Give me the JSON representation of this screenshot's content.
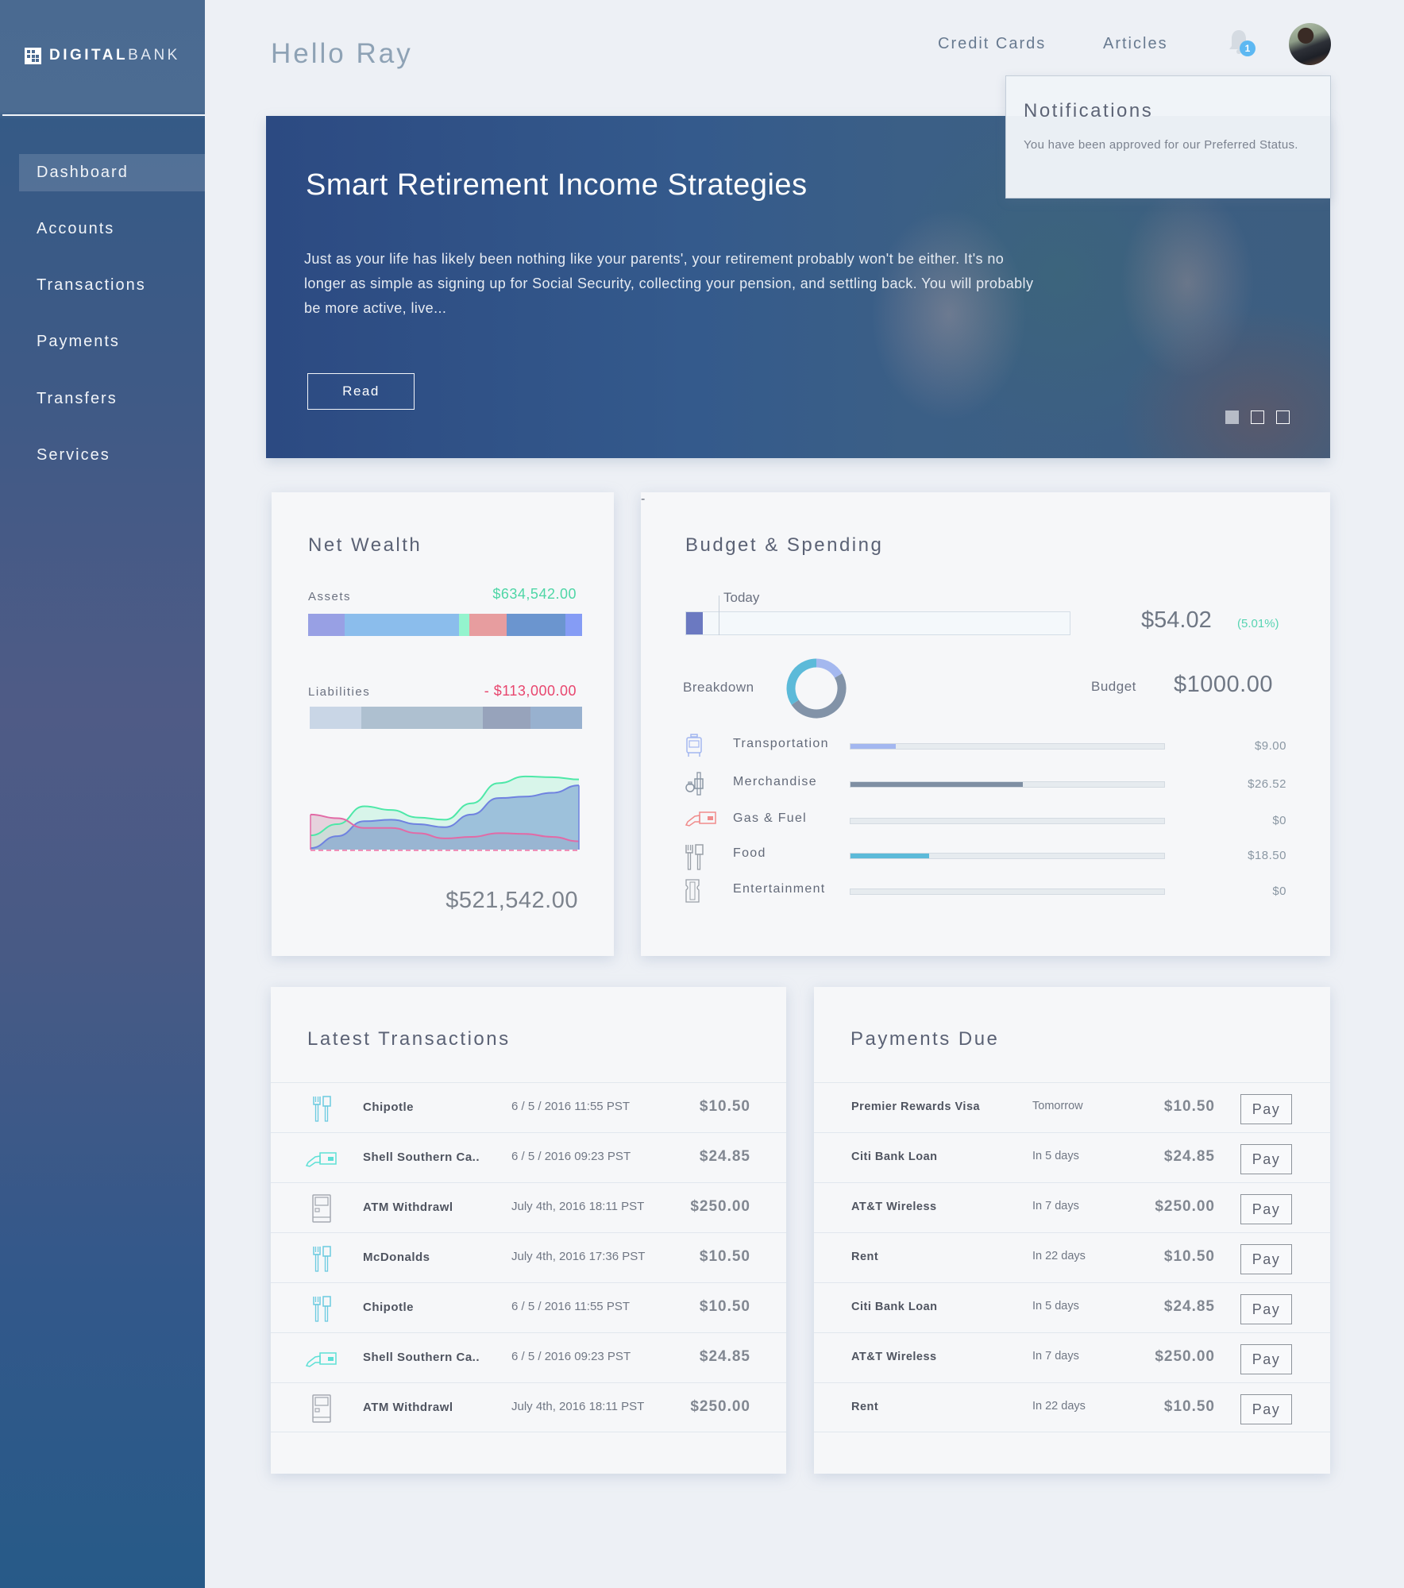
{
  "brand": {
    "name_bold": "DIGITAL",
    "name_light": "BANK",
    "icon": "logo-grid-icon"
  },
  "sidebar": {
    "items": [
      {
        "label": "Dashboard",
        "active": true
      },
      {
        "label": "Accounts",
        "active": false
      },
      {
        "label": "Transactions",
        "active": false
      },
      {
        "label": "Payments",
        "active": false
      },
      {
        "label": "Transfers",
        "active": false
      },
      {
        "label": "Services",
        "active": false
      }
    ]
  },
  "header": {
    "greeting": "Hello Ray",
    "links": [
      "Credit Cards",
      "Articles"
    ],
    "notification_icon": "bell-icon",
    "notification_count": "1",
    "avatar": "user-avatar"
  },
  "notifications": {
    "title": "Notifications",
    "message": "You have been approved for our Preferred Status."
  },
  "hero": {
    "title": "Smart Retirement Income Strategies",
    "body": "Just as your life has likely been nothing like your parents', your retirement probably won't be either. It's no longer as simple as signing up for Social Security, collecting your pension, and settling back. You will probably be more active, live...",
    "button_label": "Read",
    "slides": 3,
    "active_slide": 1
  },
  "net_wealth": {
    "title": "Net Wealth",
    "assets_label": "Assets",
    "assets_amount": "$634,542.00",
    "assets_color": "#4fd6a6",
    "liabilities_label": "Liabilities",
    "liabilities_amount": "- $113,000.00",
    "liabilities_color": "#e8466e",
    "total": "$521,542.00",
    "asset_segments": [
      {
        "share": 0.133,
        "color": "#98a0e4"
      },
      {
        "share": 0.418,
        "color": "#8bbdec"
      },
      {
        "share": 0.036,
        "color": "#94f4ce"
      },
      {
        "share": 0.137,
        "color": "#e79d9f"
      },
      {
        "share": 0.214,
        "color": "#6b95cf"
      },
      {
        "share": 0.062,
        "color": "#859cf5"
      }
    ],
    "liability_segments": [
      {
        "share": 0.189,
        "color": "#c9d6e6"
      },
      {
        "share": 0.448,
        "color": "#aec0d0"
      },
      {
        "share": 0.174,
        "color": "#97a3bb"
      },
      {
        "share": 0.189,
        "color": "#98b1cf"
      }
    ]
  },
  "chart_data": {
    "type": "area",
    "title": "",
    "xlabel": "",
    "ylabel": "",
    "grid": false,
    "legend": "none",
    "x": [
      0,
      1,
      2,
      3,
      4,
      5,
      6,
      7,
      8,
      9,
      10
    ],
    "ylim": [
      0,
      100
    ],
    "series": [
      {
        "name": "series-green",
        "color": "#4ee8a8",
        "values": [
          19,
          34,
          58,
          53,
          43,
          40,
          62,
          89,
          98,
          97,
          94
        ]
      },
      {
        "name": "series-blue",
        "color": "#6f82e0",
        "values": [
          2,
          18,
          38,
          40,
          34,
          30,
          47,
          69,
          71,
          76,
          86
        ]
      },
      {
        "name": "series-pink",
        "color": "#e26aa6",
        "values": [
          47,
          42,
          29,
          29,
          22,
          15,
          17,
          22,
          21,
          17,
          11
        ]
      }
    ]
  },
  "budget": {
    "title": "Budget & Spending",
    "today_label": "Today",
    "spent_fraction": 0.0501,
    "today_fraction": 0.09,
    "spent_amount": "$54.02",
    "spent_percent": "(5.01%)",
    "breakdown_label": "Breakdown",
    "budget_label": "Budget",
    "budget_amount": "$1000.00",
    "donut": [
      {
        "name": "Transportation",
        "value": 9.0,
        "color": "#a4b8ef"
      },
      {
        "name": "Merchandise",
        "value": 26.52,
        "color": "#8293a8"
      },
      {
        "name": "Food",
        "value": 18.5,
        "color": "#5cbad9"
      }
    ],
    "categories": [
      {
        "name": "Transportation",
        "amount": "$9.00",
        "fraction": 0.145,
        "color": "#a3b7f0",
        "icon": "bus-icon",
        "icon_color": "#a3b7f0"
      },
      {
        "name": "Merchandise",
        "amount": "$26.52",
        "fraction": 0.55,
        "color": "#7f8fa3",
        "icon": "merchandise-icon",
        "icon_color": "#8995a3"
      },
      {
        "name": "Gas & Fuel",
        "amount": "$0",
        "fraction": 0,
        "color": "#e0a0a0",
        "icon": "fuel-pump-icon",
        "icon_color": "#f08c8c"
      },
      {
        "name": "Food",
        "amount": "$18.50",
        "fraction": 0.25,
        "color": "#5cbad9",
        "icon": "fork-knife-icon",
        "icon_color": "#9aa0a8"
      },
      {
        "name": "Entertainment",
        "amount": "$0",
        "fraction": 0,
        "color": "#cfd6dd",
        "icon": "ticket-icon",
        "icon_color": "#9aa0a8"
      }
    ]
  },
  "transactions": {
    "title": "Latest Transactions",
    "rows": [
      {
        "icon": "fork-knife-icon",
        "name": "Chipotle",
        "date": "6 / 5 / 2016  11:55 PST",
        "amount": "$10.50"
      },
      {
        "icon": "fuel-pump-icon",
        "name": "Shell Southern Ca..",
        "date": "6 / 5 / 2016  09:23 PST",
        "amount": "$24.85"
      },
      {
        "icon": "atm-icon",
        "name": "ATM Withdrawl",
        "date": "July 4th, 2016  18:11 PST",
        "amount": "$250.00"
      },
      {
        "icon": "fork-knife-icon",
        "name": "McDonalds",
        "date": "July 4th, 2016  17:36 PST",
        "amount": "$10.50"
      },
      {
        "icon": "fork-knife-icon",
        "name": "Chipotle",
        "date": "6 / 5 / 2016  11:55 PST",
        "amount": "$10.50"
      },
      {
        "icon": "fuel-pump-icon",
        "name": "Shell Southern Ca..",
        "date": "6 / 5 / 2016  09:23 PST",
        "amount": "$24.85"
      },
      {
        "icon": "atm-icon",
        "name": "ATM Withdrawl",
        "date": "July 4th, 2016  18:11 PST",
        "amount": "$250.00"
      }
    ]
  },
  "payments": {
    "title": "Payments Due",
    "pay_label": "Pay",
    "rows": [
      {
        "name": "Premier Rewards Visa",
        "due": "Tomorrow",
        "amount": "$10.50"
      },
      {
        "name": "Citi Bank Loan",
        "due": "In 5 days",
        "amount": "$24.85"
      },
      {
        "name": "AT&T Wireless",
        "due": "In 7 days",
        "amount": "$250.00"
      },
      {
        "name": "Rent",
        "due": "In 22 days",
        "amount": "$10.50"
      },
      {
        "name": "Citi Bank Loan",
        "due": "In 5 days",
        "amount": "$24.85"
      },
      {
        "name": "AT&T Wireless",
        "due": "In 7 days",
        "amount": "$250.00"
      },
      {
        "name": "Rent",
        "due": "In 22 days",
        "amount": "$10.50"
      }
    ]
  }
}
